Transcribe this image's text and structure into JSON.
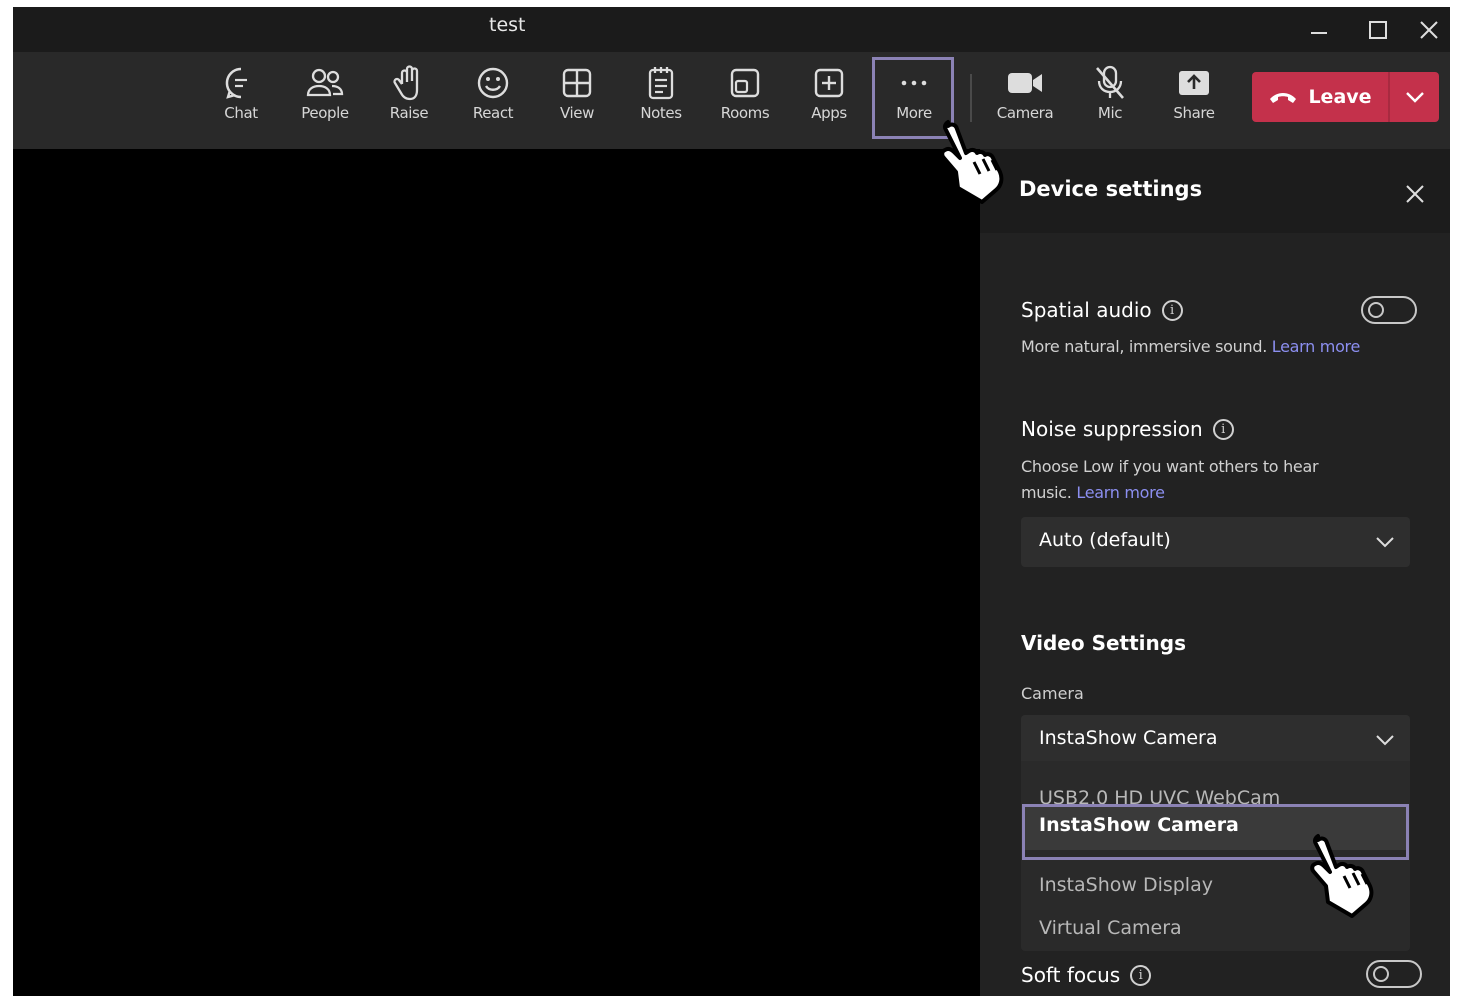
{
  "window": {
    "title": "test"
  },
  "toolbar": {
    "items": [
      {
        "label": "Chat",
        "icon": "chat-icon"
      },
      {
        "label": "People",
        "icon": "people-icon"
      },
      {
        "label": "Raise",
        "icon": "raise-hand-icon"
      },
      {
        "label": "React",
        "icon": "smiley-icon"
      },
      {
        "label": "View",
        "icon": "grid-icon"
      },
      {
        "label": "Notes",
        "icon": "notes-icon"
      },
      {
        "label": "Rooms",
        "icon": "rooms-icon"
      },
      {
        "label": "Apps",
        "icon": "plus-box-icon"
      },
      {
        "label": "More",
        "icon": "ellipsis-icon"
      },
      {
        "label": "Camera",
        "icon": "camera-icon"
      },
      {
        "label": "Mic",
        "icon": "mic-off-icon"
      },
      {
        "label": "Share",
        "icon": "share-icon"
      }
    ],
    "leave_label": "Leave"
  },
  "panel": {
    "title": "Device settings",
    "spatial": {
      "title": "Spatial audio",
      "desc": "More natural, immersive sound.",
      "link": "Learn more",
      "enabled": false
    },
    "noise": {
      "title": "Noise suppression",
      "desc": "Choose Low if you want others to hear music.",
      "link": "Learn more",
      "value": "Auto (default)"
    },
    "video": {
      "title": "Video Settings",
      "camera_label": "Camera",
      "camera_value": "InstaShow Camera",
      "options": [
        "USB2.0 HD UVC WebCam",
        "InstaShow Camera",
        "InstaShow Display",
        "Virtual Camera"
      ],
      "selected_index": 1
    },
    "soft_focus": {
      "title": "Soft focus",
      "enabled": false
    }
  },
  "colors": {
    "leave": "#c4314b",
    "highlight": "#8b82b5",
    "link": "#8c8ff0"
  }
}
